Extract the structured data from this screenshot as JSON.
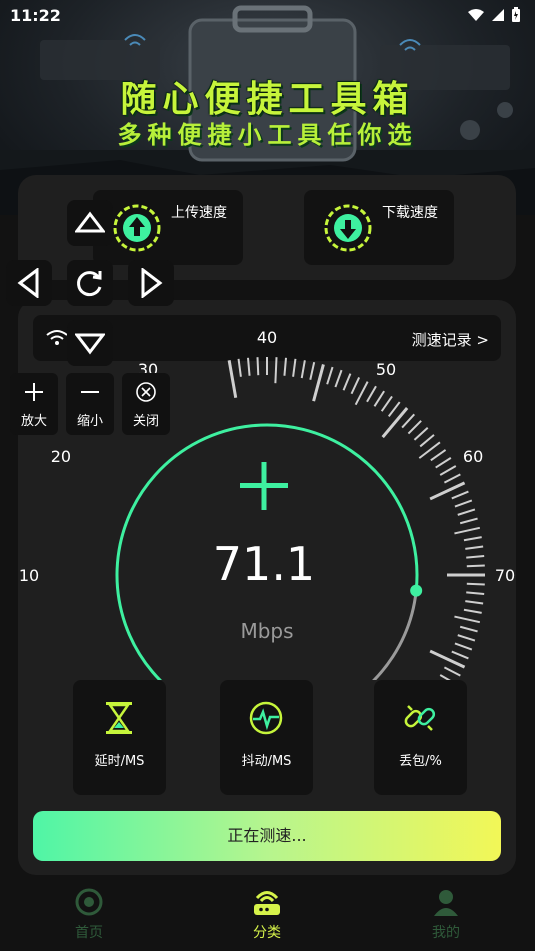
{
  "status_bar": {
    "time": "11:22"
  },
  "banner": {
    "title": "随心便捷工具箱",
    "subtitle": "多种便捷小工具任你选"
  },
  "speed": {
    "upload_label": "上传速度",
    "download_label": "下载速度"
  },
  "record": {
    "label": "测速记录  >"
  },
  "gauge": {
    "value": "71.1",
    "unit": "Mbps",
    "ticks": [
      "10",
      "20",
      "30",
      "40",
      "50",
      "60",
      "70"
    ],
    "accent": "#3ef0a0"
  },
  "metrics": [
    {
      "label": "延时/MS",
      "icon": "hourglass-icon"
    },
    {
      "label": "抖动/MS",
      "icon": "pulse-icon"
    },
    {
      "label": "丢包/%",
      "icon": "broken-link-icon"
    }
  ],
  "action": {
    "label": "正在测速..."
  },
  "nav": [
    {
      "label": "首页",
      "active": false
    },
    {
      "label": "分类",
      "active": true
    },
    {
      "label": "我的",
      "active": false
    }
  ],
  "zoom": {
    "zoom_in": "放大",
    "zoom_out": "缩小",
    "close": "关闭"
  },
  "colors": {
    "brand": "#c6f53b",
    "accent": "#3ef0a0",
    "active_nav": "#d6f24a",
    "inactive_nav": "#2f5a3a"
  }
}
